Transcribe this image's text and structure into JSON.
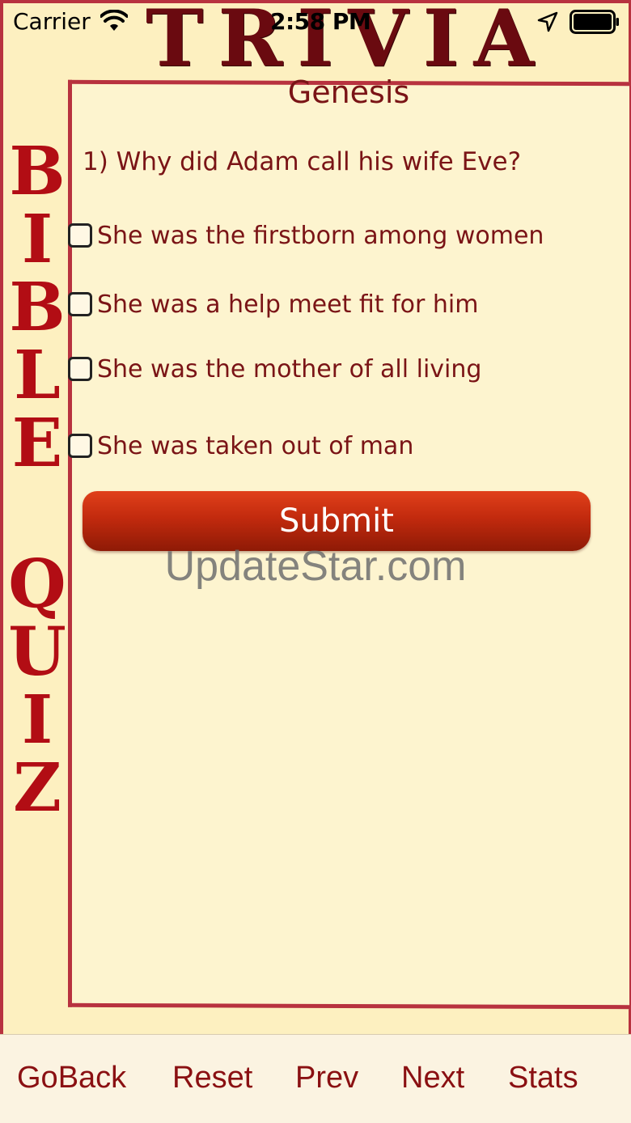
{
  "status_bar": {
    "carrier": "Carrier",
    "time": "2:58 PM"
  },
  "banner": {
    "title": "TRIVIA",
    "side_title_letters": [
      "B",
      "I",
      "B",
      "L",
      "E",
      "Q",
      "U",
      "I",
      "Z"
    ]
  },
  "quiz": {
    "chapter": "Genesis",
    "question": "1) Why did Adam call his wife Eve?",
    "answers": [
      {
        "label": "She was the firstborn among women",
        "checked": false
      },
      {
        "label": "She was a help meet fit for him",
        "checked": false
      },
      {
        "label": "She was the mother of all living",
        "checked": false
      },
      {
        "label": "She was taken out of man",
        "checked": false
      }
    ],
    "submit_label": "Submit"
  },
  "watermark": "UpdateStar.com",
  "toolbar": {
    "items": [
      "GoBack",
      "Reset",
      "Prev",
      "Next",
      "Stats"
    ]
  },
  "colors": {
    "accent": "#b20d14",
    "text": "#7a1416",
    "background": "#fdf2c6",
    "button": "#c22a0e"
  },
  "icons": [
    "wifi-icon",
    "location-arrow-icon",
    "battery-icon"
  ]
}
